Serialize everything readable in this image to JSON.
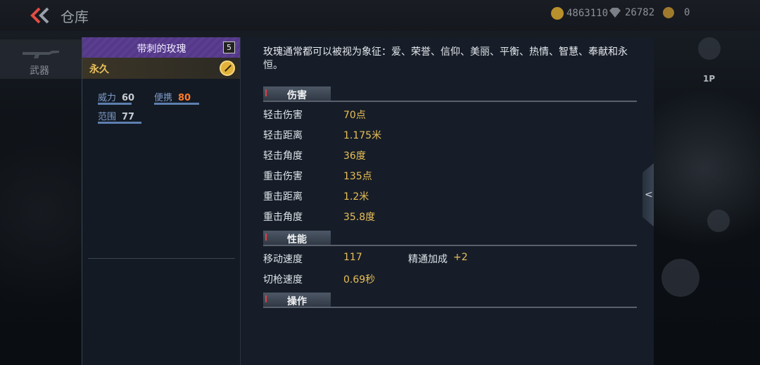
{
  "topbar": {
    "title": "仓库",
    "currency_gold": "4863110",
    "currency_diamond": "26782",
    "currency_other": "0"
  },
  "left_tab": {
    "label": "武器"
  },
  "card": {
    "title": "带刺的玫瑰",
    "level": "5",
    "duration": "永久",
    "stats": [
      {
        "label": "威力",
        "value": "60",
        "value_color": "#c8ccd2",
        "bar_fraction": 0.6
      },
      {
        "label": "便携",
        "value": "80",
        "value_color": "#ff7a2a",
        "bar_fraction": 0.8
      },
      {
        "label": "范围",
        "value": "77",
        "value_color": "#c8ccd2",
        "bar_fraction": 0.77
      }
    ]
  },
  "info": {
    "description": "玫瑰通常都可以被视为象征：爱、荣誉、信仰、美丽、平衡、热情、智慧、奉献和永恒。",
    "sections": {
      "damage": {
        "title": "伤害",
        "rows": [
          {
            "label": "轻击伤害",
            "value": "70点"
          },
          {
            "label": "轻击距离",
            "value": "1.175米"
          },
          {
            "label": "轻击角度",
            "value": "36度"
          },
          {
            "label": "重击伤害",
            "value": "135点"
          },
          {
            "label": "重击距离",
            "value": "1.2米"
          },
          {
            "label": "重击角度",
            "value": "35.8度"
          }
        ]
      },
      "performance": {
        "title": "性能",
        "move_speed_label": "移动速度",
        "move_speed_value": "117",
        "mastery_label": "精通加成",
        "mastery_value": "+2",
        "switch_label": "切枪速度",
        "switch_value": "0.69秒"
      },
      "operation": {
        "title": "操作"
      }
    }
  },
  "hud": {
    "view_label": "1P"
  },
  "colors": {
    "accent_gold": "#e9bf57",
    "rarity_purple": "#5b3f8e"
  }
}
